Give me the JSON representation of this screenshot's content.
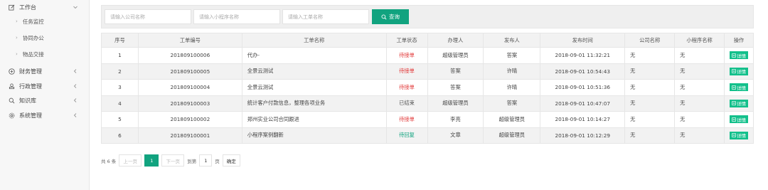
{
  "sidebar": {
    "workbench": {
      "label": "工作台",
      "icon": "edit-icon"
    },
    "sub_items": [
      {
        "label": "任务监控"
      },
      {
        "label": "协同办公"
      },
      {
        "label": "物品交接"
      }
    ],
    "items": [
      {
        "label": "财务管理",
        "icon": "plus-circle-icon"
      },
      {
        "label": "行政管理",
        "icon": "stamp-icon"
      },
      {
        "label": "知识库",
        "icon": "search-icon"
      },
      {
        "label": "系统管理",
        "icon": "gear-icon"
      }
    ]
  },
  "search": {
    "company_placeholder": "请输入公司名称",
    "miniapp_placeholder": "请输入小程序名称",
    "order_placeholder": "请输入工单名称",
    "button_label": "查询"
  },
  "table": {
    "headers": [
      "序号",
      "工单编号",
      "工单名称",
      "工单状态",
      "办理人",
      "发布人",
      "发布时间",
      "公司名称",
      "小程序名称",
      "操作"
    ],
    "rows": [
      {
        "index": "1",
        "code": "201809100006",
        "name": "代办-",
        "status": "待接单",
        "status_color": "red",
        "handler": "超级管理员",
        "publisher": "答案",
        "time": "2018-09-01 11:32:21",
        "company": "无",
        "miniapp": "无",
        "action": "详情"
      },
      {
        "index": "2",
        "code": "201809100005",
        "name": "全景云测试",
        "status": "待接单",
        "status_color": "red",
        "handler": "答案",
        "publisher": "许晴",
        "time": "2018-09-01 10:54:43",
        "company": "无",
        "miniapp": "无",
        "action": "详情"
      },
      {
        "index": "3",
        "code": "201809100004",
        "name": "全景云测试",
        "status": "待接单",
        "status_color": "red",
        "handler": "答案",
        "publisher": "许晴",
        "time": "2018-09-01 10:51:36",
        "company": "无",
        "miniapp": "无",
        "action": "详情"
      },
      {
        "index": "4",
        "code": "201809100003",
        "name": "统计客户付款信息，整理各项业务",
        "status": "已结束",
        "status_color": "gray",
        "handler": "超级管理员",
        "publisher": "答案",
        "time": "2018-09-01 10:47:07",
        "company": "无",
        "miniapp": "无",
        "action": "详情"
      },
      {
        "index": "5",
        "code": "201809100002",
        "name": "郑州实业公司合同跟进",
        "status": "待接单",
        "status_color": "red",
        "handler": "李亮",
        "publisher": "超级管理员",
        "time": "2018-09-01 10:14:27",
        "company": "无",
        "miniapp": "无",
        "action": "详情"
      },
      {
        "index": "6",
        "code": "201809100001",
        "name": "小程序案例翻新",
        "status": "待回复",
        "status_color": "green",
        "handler": "文章",
        "publisher": "超级管理员",
        "time": "2018-09-01 10:12:29",
        "company": "无",
        "miniapp": "无",
        "action": "详情"
      }
    ]
  },
  "pager": {
    "total": "共 6 条",
    "prev": "上一页",
    "current": "1",
    "next": "下一页",
    "goto": "到第",
    "page_input": "1",
    "page_unit": "页",
    "confirm": "确定"
  },
  "colors": {
    "accent": "#11a37f",
    "detail": "#13c08b",
    "status_red": "#e23b3b"
  }
}
